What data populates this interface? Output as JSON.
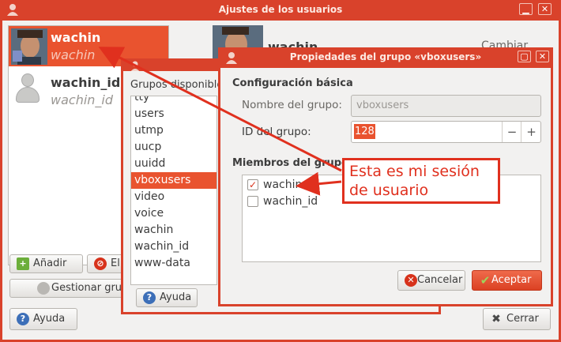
{
  "main_window": {
    "title": "Ajustes de los usuarios",
    "users": [
      {
        "name": "wachin",
        "login": "wachin"
      },
      {
        "name": "wachin_id",
        "login": "wachin_id"
      }
    ],
    "profile_name": "wachin",
    "change_label": "Cambiar",
    "add_label": "Añadir",
    "delete_label": "Eliminar",
    "manage_groups_label": "Gestionar grupos",
    "help_label": "Ayuda",
    "close_label": "Cerrar"
  },
  "groups_window": {
    "title": "Grupos disponibles",
    "items": [
      "tty",
      "users",
      "utmp",
      "uucp",
      "uuidd",
      "vboxusers",
      "video",
      "voice",
      "wachin",
      "wachin_id",
      "www-data"
    ],
    "selected": "vboxusers",
    "help_label": "Ayuda"
  },
  "properties_dialog": {
    "title": "Propiedades del grupo «vboxusers»",
    "basic_section": "Configuración básica",
    "group_name_label": "Nombre del grupo:",
    "group_name_value": "vboxusers",
    "group_id_label": "ID del grupo:",
    "group_id_value": "128",
    "members_section": "Miembros del grupo",
    "members": [
      {
        "name": "wachin",
        "checked": true
      },
      {
        "name": "wachin_id",
        "checked": false
      }
    ],
    "cancel_label": "Cancelar",
    "accept_label": "Aceptar"
  },
  "annotation": {
    "line1": "Esta es mi sesión",
    "line2": "de usuario"
  },
  "colors": {
    "accent": "#e9532f",
    "annotation_red": "#e0301e"
  }
}
